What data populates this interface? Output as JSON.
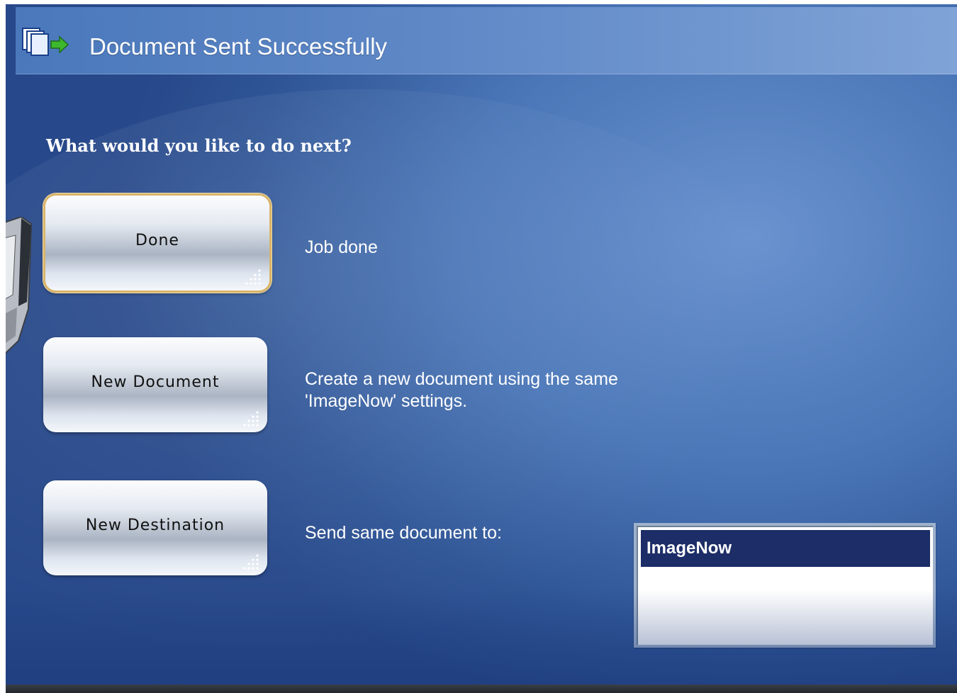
{
  "header": {
    "title": "Document Sent Successfully",
    "icon": "document-send-icon"
  },
  "prompt": "What would you like to do next?",
  "actions": [
    {
      "label": "Done",
      "description": "Job done",
      "selected": true
    },
    {
      "label": "New Document",
      "description": "Create a new document using the same 'ImageNow' settings.",
      "selected": false
    },
    {
      "label": "New Destination",
      "description": "Send same document to:",
      "selected": false
    }
  ],
  "destinations": {
    "items": [
      "ImageNow"
    ],
    "selected": "ImageNow"
  },
  "colors": {
    "background": "#4b77b8",
    "header": "#5f88c6",
    "selected_border": "#d9b56a",
    "list_highlight": "#1c2d67"
  }
}
